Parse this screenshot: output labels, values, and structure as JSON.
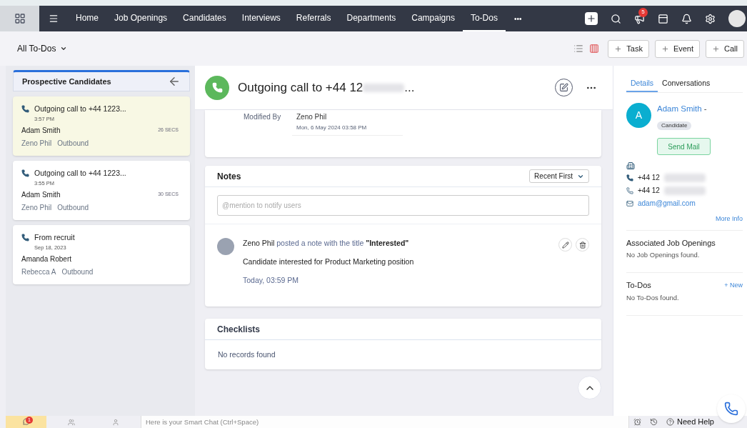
{
  "nav": {
    "items": [
      {
        "label": "Home",
        "selected": false
      },
      {
        "label": "Job Openings",
        "selected": false
      },
      {
        "label": "Candidates",
        "selected": false
      },
      {
        "label": "Interviews",
        "selected": false
      },
      {
        "label": "Referrals",
        "selected": false
      },
      {
        "label": "Departments",
        "selected": false
      },
      {
        "label": "Campaigns",
        "selected": false
      },
      {
        "label": "To-Dos",
        "selected": true
      }
    ],
    "more": "•••",
    "notification_count": "5"
  },
  "toolbar": {
    "view": "All To-Dos",
    "buttons": [
      {
        "label": "Task"
      },
      {
        "label": "Event"
      },
      {
        "label": "Call"
      }
    ]
  },
  "list_panel": {
    "title": "Prospective Candidates",
    "items": [
      {
        "title": "Outgoing call to +44 1223...",
        "time": "3:57 PM",
        "contact": "Adam Smith",
        "duration": "26 SECS",
        "owner": "Zeno Phil",
        "direction": "Outbound",
        "selected": true
      },
      {
        "title": "Outgoing call to +44 1223...",
        "time": "3:55 PM",
        "contact": "Adam Smith",
        "duration": "30 SECS",
        "owner": "Zeno Phil",
        "direction": "Outbound",
        "selected": false
      },
      {
        "title": "From recruit",
        "time": "Sep 18, 2023",
        "contact": "Amanda Robert",
        "owner": "Rebecca A",
        "direction": "Outbound",
        "selected": false
      }
    ]
  },
  "detail": {
    "title": "Outgoing call to +44 12",
    "title_end": "...",
    "modified_label": "Modified By",
    "modified_by": "Zeno Phil",
    "modified_at": "Mon, 6 May 2024 03:58 PM",
    "notes": {
      "heading": "Notes",
      "sort": "Recent First",
      "placeholder": "@mention to notify users",
      "entries": [
        {
          "author": "Zeno Phil",
          "action": " posted a note with the title ",
          "note_title": "\"Interested\"",
          "body": "Candidate interested for Product Marketing position",
          "time": "Today, 03:59 PM"
        }
      ]
    },
    "checklists": {
      "heading": "Checklists",
      "empty": "No records found"
    }
  },
  "side": {
    "tabs": [
      {
        "label": "Details",
        "selected": true
      },
      {
        "label": "Conversations",
        "selected": false
      }
    ],
    "initial": "A",
    "name": "Adam Smith",
    "name_suffix": "-",
    "role": "Candidate",
    "send_mail": "Send Mail",
    "phone": "+44 12",
    "mobile": "+44 12",
    "email": "adam@gmail.com",
    "more_info": "More Info",
    "sections": [
      {
        "heading": "Associated Job Openings",
        "empty": "No Job Openings found."
      },
      {
        "heading": "To-Dos",
        "action": "+ New",
        "empty": "No To-Dos found."
      }
    ]
  },
  "bottom": {
    "unread_count": "1",
    "chat_placeholder": "Here is your Smart Chat (Ctrl+Space)",
    "help": "Need Help"
  }
}
